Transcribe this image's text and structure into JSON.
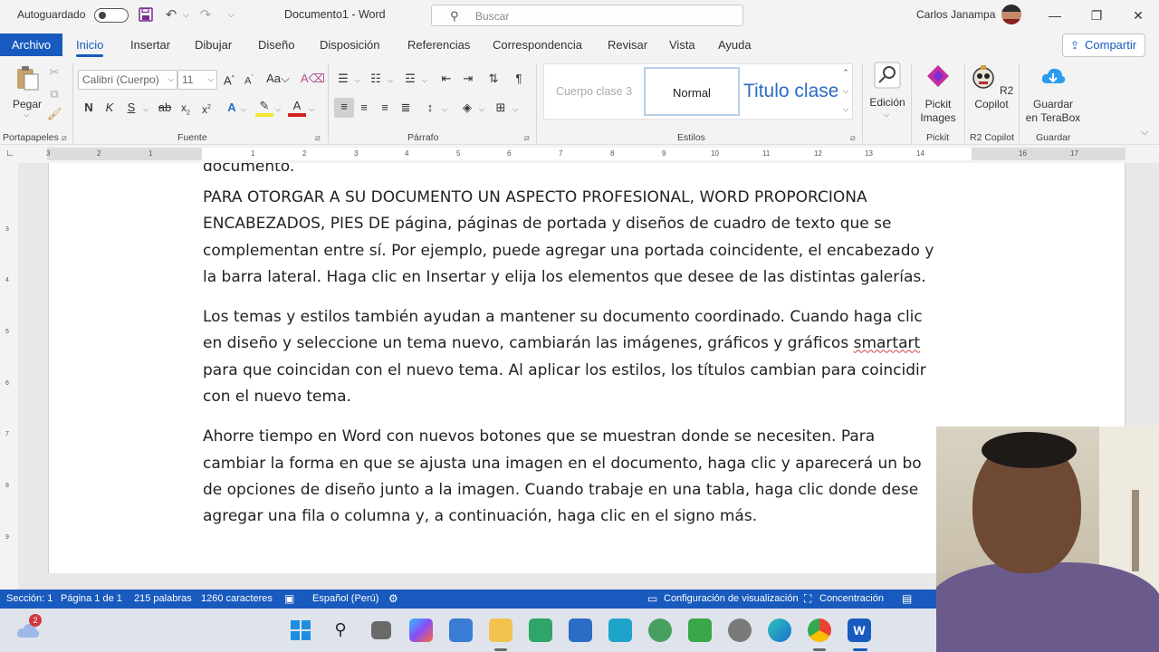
{
  "titlebar": {
    "autosave_label": "Autoguardado",
    "document_title": "Documento1 - Word",
    "search_placeholder": "Buscar",
    "user_name": "Carlos Janampa"
  },
  "tabs": {
    "file": "Archivo",
    "items": [
      "Inicio",
      "Insertar",
      "Dibujar",
      "Diseño",
      "Disposición",
      "Referencias",
      "Correspondencia",
      "Revisar",
      "Vista",
      "Ayuda"
    ],
    "active": "Inicio",
    "share": "Compartir"
  },
  "ribbon": {
    "clipboard": {
      "paste": "Pegar",
      "group_label": "Portapapeles"
    },
    "font": {
      "font_name": "Calibri (Cuerpo)",
      "font_size": "11",
      "bold": "N",
      "italic": "K",
      "underline": "S",
      "strike": "ab",
      "group_label": "Fuente"
    },
    "paragraph": {
      "group_label": "Párrafo"
    },
    "styles": {
      "items": [
        "Cuerpo clase 3",
        "Normal",
        "Titulo clase"
      ],
      "group_label": "Estilos"
    },
    "editing": {
      "label": "Edición"
    },
    "pickit": {
      "label_line1": "Pickit",
      "label_line2": "Images",
      "group_label": "Pickit"
    },
    "r2copilot": {
      "label_line1": "R2",
      "label_line2": "Copilot",
      "group_label": "R2 Copilot"
    },
    "terabox": {
      "label_line1": "Guardar",
      "label_line2": "en TeraBox",
      "group_label": "Guardar"
    }
  },
  "ruler": {
    "ticks": [
      "3",
      "2",
      "1",
      "1",
      "2",
      "3",
      "4",
      "5",
      "6",
      "7",
      "8",
      "9",
      "10",
      "11",
      "12",
      "13",
      "14",
      "16",
      "17"
    ]
  },
  "document": {
    "prev_fragment": "documento.",
    "paragraphs": [
      [
        "PARA OTORGAR A SU DOCUMENTO UN ASPECTO PROFESIONAL, WORD PROPORCIONA",
        "ENCABEZADOS, PIES DE página, páginas de portada y diseños de cuadro de texto que se",
        "complementan entre sí. Por ejemplo, puede agregar una portada coincidente, el encabezado y",
        "la barra lateral. Haga clic en Insertar y elija los elementos que desee de las distintas galerías."
      ],
      [
        "Los temas y estilos también ayudan a mantener su documento coordinado. Cuando haga clic",
        "en diseño y seleccione un tema nuevo, cambiarán las imágenes, gráficos y gráficos ",
        "para que coincidan con el nuevo tema. Al aplicar los estilos, los títulos cambian para coincidir",
        "con el nuevo tema."
      ],
      [
        "Ahorre tiempo en Word con nuevos botones que se muestran donde se necesiten. Para",
        "cambiar la forma en que se ajusta una imagen en el documento, haga clic y aparecerá un bo",
        "de opciones de diseño junto a la imagen. Cuando trabaje en una tabla, haga clic donde dese",
        "agregar una fila o columna y, a continuación, haga clic en el signo más."
      ]
    ],
    "misspelled_word": "smartart"
  },
  "statusbar": {
    "section": "Sección: 1",
    "page": "Página 1 de 1",
    "words": "215 palabras",
    "chars": "1260 caracteres",
    "language": "Español (Perú)",
    "display_settings": "Configuración de visualización",
    "focus": "Concentración"
  },
  "taskbar": {
    "notification_count": "2"
  },
  "colors": {
    "accent": "#185abd",
    "ribbon_bg": "#f3f3f3",
    "taskbar_bg": "#dfe4ec"
  }
}
